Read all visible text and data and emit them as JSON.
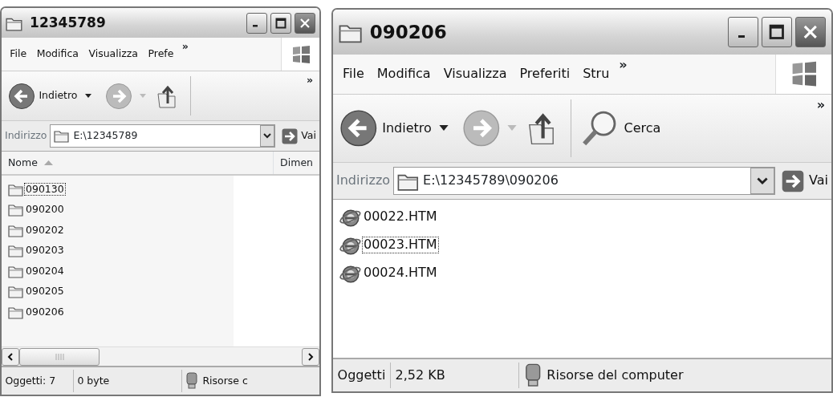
{
  "windows": [
    {
      "title": "12345789",
      "menu": [
        "File",
        "Modifica",
        "Visualizza",
        "Prefe"
      ],
      "menu_more": "»",
      "toolbar": {
        "back_label": "Indietro",
        "more": "»"
      },
      "address": {
        "label": "Indirizzo",
        "value": "E:\\12345789",
        "go_label": "Vai"
      },
      "columns": [
        {
          "label": "Nome",
          "sort_ascending": true
        },
        {
          "label": "Dimen",
          "sort_ascending": false
        }
      ],
      "items": [
        {
          "kind": "folder",
          "name": "090130",
          "focused": true
        },
        {
          "kind": "folder",
          "name": "090200",
          "focused": false
        },
        {
          "kind": "folder",
          "name": "090202",
          "focused": false
        },
        {
          "kind": "folder",
          "name": "090203",
          "focused": false
        },
        {
          "kind": "folder",
          "name": "090204",
          "focused": false
        },
        {
          "kind": "folder",
          "name": "090205",
          "focused": false
        },
        {
          "kind": "folder",
          "name": "090206",
          "focused": false
        }
      ],
      "scrollbar": {
        "kind": "horizontal"
      },
      "status_bar": [
        "Oggetti: 7",
        "0 byte",
        "Risorse c"
      ]
    },
    {
      "title": "090206",
      "menu": [
        "File",
        "Modifica",
        "Visualizza",
        "Preferiti",
        "Stru"
      ],
      "menu_more": "»",
      "toolbar": {
        "back_label": "Indietro",
        "search_label": "Cerca",
        "more": "»"
      },
      "address": {
        "label": "Indirizzo",
        "value": "E:\\12345789\\090206",
        "go_label": "Vai"
      },
      "items": [
        {
          "kind": "web-page",
          "name": "00022.HTM",
          "focused": false
        },
        {
          "kind": "web-page",
          "name": "00023.HTM",
          "focused": true
        },
        {
          "kind": "web-page",
          "name": "00024.HTM",
          "focused": false
        }
      ],
      "status_bar": [
        "Oggetti",
        "2,52 KB",
        "Risorse del computer"
      ]
    }
  ]
}
